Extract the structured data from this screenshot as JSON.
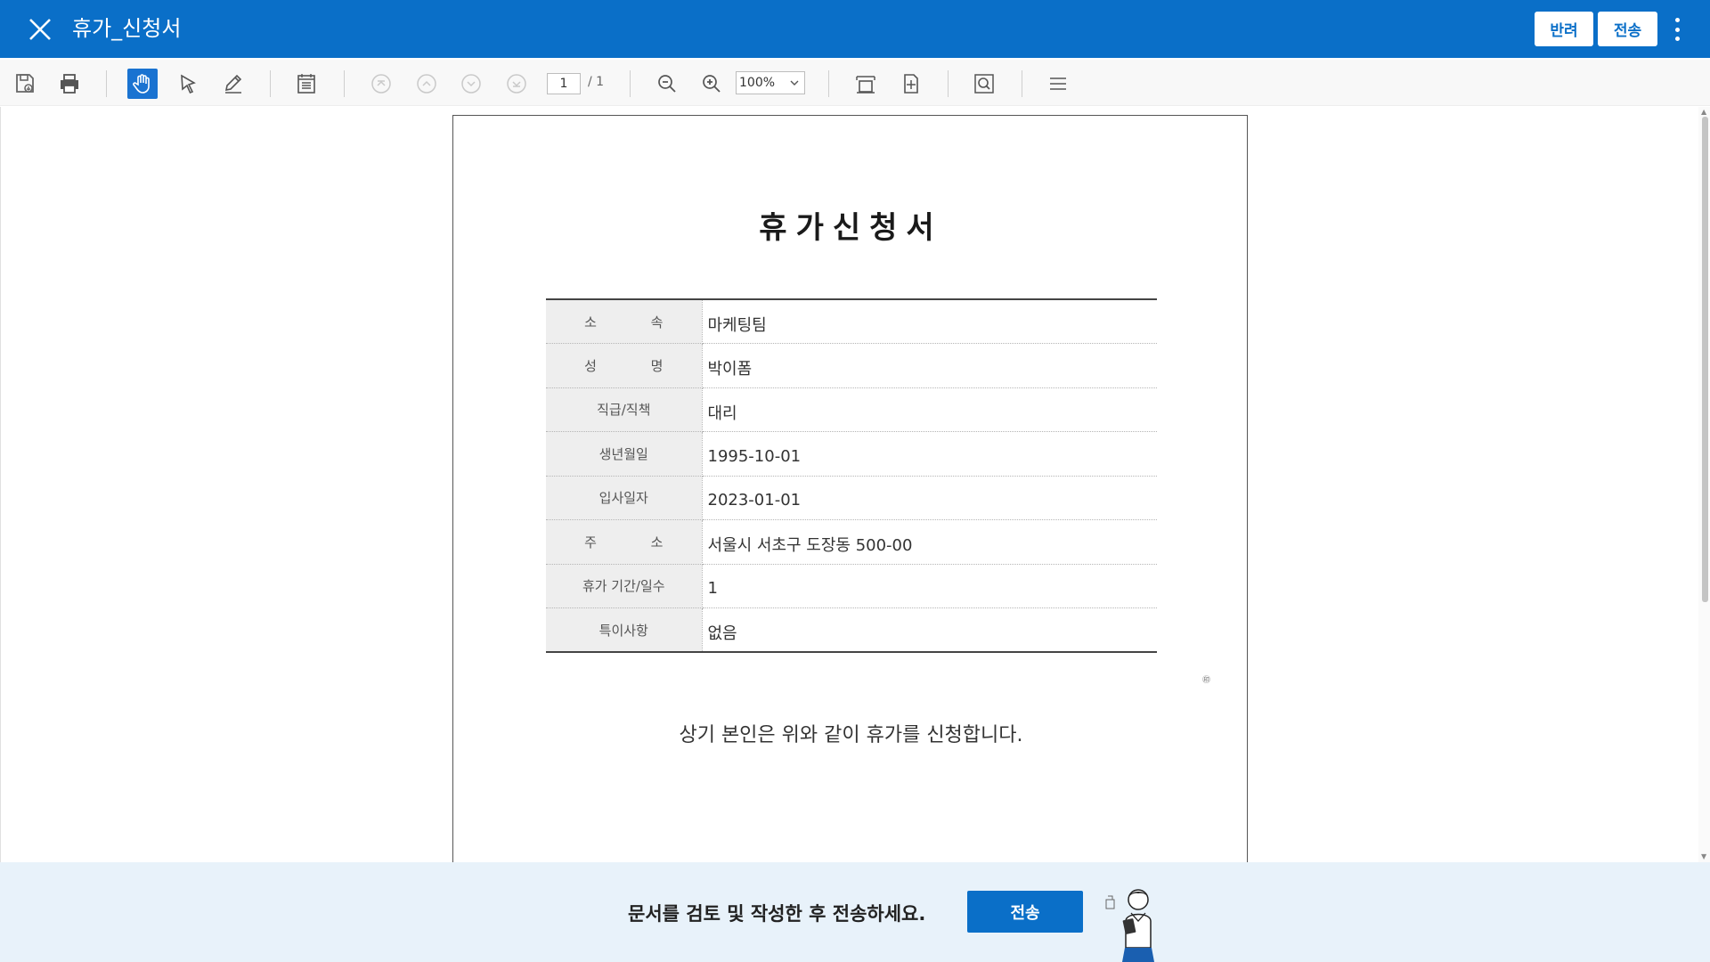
{
  "header": {
    "title": "휴가_신청서",
    "reject_label": "반려",
    "send_label": "전송"
  },
  "toolbar": {
    "page_current": "1",
    "page_total": "/  1",
    "zoom": "100%"
  },
  "document": {
    "title": "휴가신청서",
    "rows": [
      {
        "label": "소 속",
        "value": "마케팅팀"
      },
      {
        "label": "성 명",
        "value": "박이폼"
      },
      {
        "label": "직급/직책",
        "value": "대리"
      },
      {
        "label": "생년월일",
        "value": "1995-10-01"
      },
      {
        "label": "입사일자",
        "value": "2023-01-01"
      },
      {
        "label": "주 소",
        "value": "서울시 서초구 도장동 500-00"
      },
      {
        "label": "휴가 기간/일수",
        "value": "1"
      },
      {
        "label": "특이사항",
        "value": "없음"
      }
    ],
    "mark": "㊞",
    "statement": "상기 본인은 위와 같이 휴가를 신청합니다."
  },
  "footer": {
    "message": "문서를 검토 및 작성한 후 전송하세요.",
    "send_label": "전송"
  },
  "colors": {
    "brand": "#0a6fc8",
    "footer_bg": "#e8f2fa"
  }
}
